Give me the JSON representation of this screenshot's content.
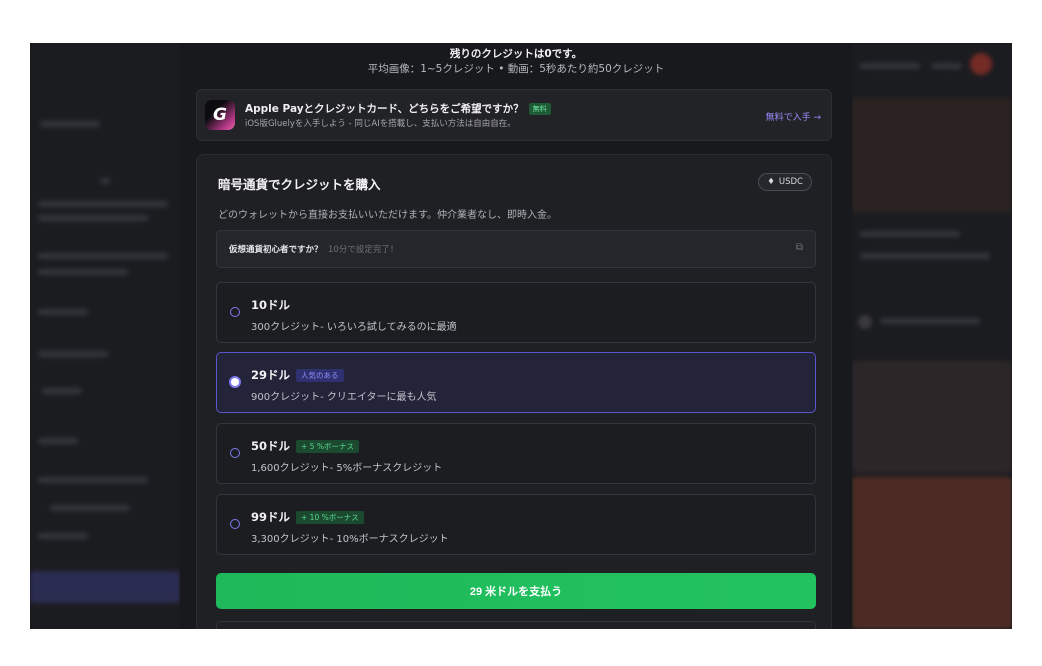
{
  "notice": {
    "line1": "残りのクレジットは0です。",
    "line2": "平均画像：1~5クレジット • 動画：5秒あたり約50クレジット"
  },
  "promo": {
    "logo_letter": "G",
    "title": "Apple Payとクレジットカード、どちらをご希望ですか？",
    "badge": "無料",
    "subtitle": "iOS版Gluelyを入手しよう - 同じAIを搭載し、支払い方法は自由自在。",
    "link": "無料で入手 →"
  },
  "crypto": {
    "title": "暗号通貨でクレジットを購入",
    "currency_badge": "USDC",
    "currency_icon": "ethereum-icon",
    "subtitle": "どのウォレットから直接お支払いいただけます。仲介業者なし、即時入金。",
    "beginner": {
      "title": "仮想通貨初心者ですか？",
      "hint": "10分で設定完了！",
      "icon": "external-link-icon"
    },
    "options": [
      {
        "title": "10ドル",
        "tag": "",
        "desc": "300クレジット- いろいろ試してみるのに最適",
        "selected": false
      },
      {
        "title": "29ドル",
        "tag": "人気のある",
        "desc": "900クレジット- クリエイターに最も人気",
        "selected": true
      },
      {
        "title": "50ドル",
        "tag": "+ 5 %ボーナス",
        "desc": "1,600クレジット- 5%ボーナスクレジット",
        "selected": false
      },
      {
        "title": "99ドル",
        "tag": "+ 10 %ボーナス",
        "desc": "3,300クレジット- 10%ボーナスクレジット",
        "selected": false
      }
    ],
    "pay_button": "29 米ドルを支払う"
  },
  "colors": {
    "accent": "#7d7af0",
    "pay_green": "#22c35f",
    "bonus_green": "#59d68b"
  }
}
